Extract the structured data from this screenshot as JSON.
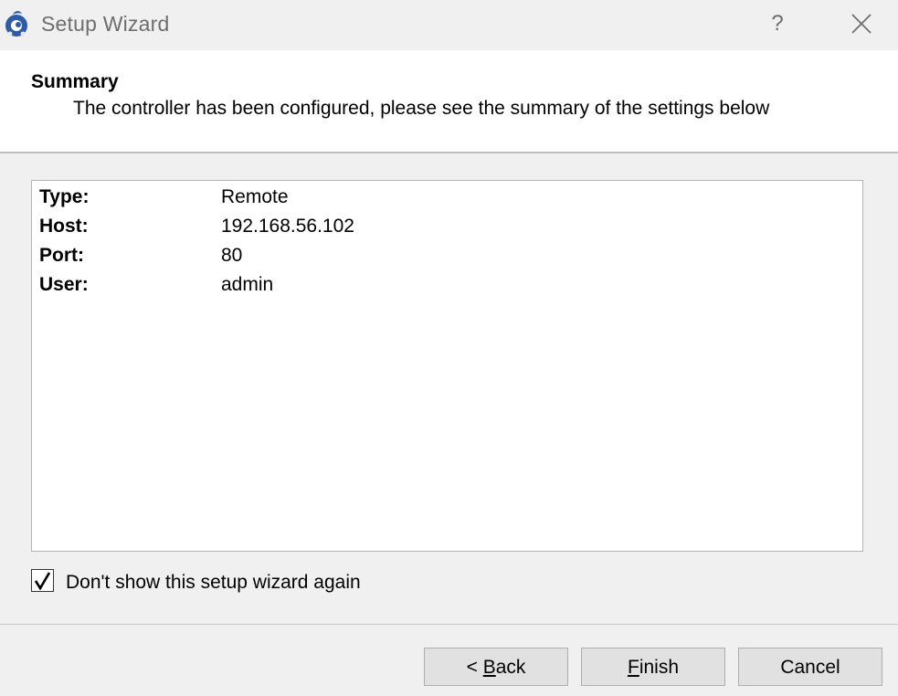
{
  "window": {
    "title": "Setup Wizard",
    "help_label": "?",
    "icon": "app-logo-icon",
    "close_icon": "close-icon"
  },
  "header": {
    "title": "Summary",
    "subtitle": "The controller has been configured, please see the summary of the settings below"
  },
  "summary": {
    "rows": [
      {
        "key": "Type:",
        "value": "Remote"
      },
      {
        "key": "Host:",
        "value": "192.168.56.102"
      },
      {
        "key": "Port:",
        "value": "80"
      },
      {
        "key": "User:",
        "value": "admin"
      }
    ]
  },
  "options": {
    "dont_show_label": "Don't show this setup wizard again",
    "dont_show_checked": true
  },
  "buttons": {
    "back_prefix": "< ",
    "back_accel": "B",
    "back_rest": "ack",
    "finish_accel": "F",
    "finish_rest": "inish",
    "cancel": "Cancel"
  },
  "colors": {
    "window_bg": "#f0f0f0",
    "header_bg": "#ffffff",
    "title_text": "#6d6d6d",
    "icon_blue": "#2e5aa8"
  }
}
